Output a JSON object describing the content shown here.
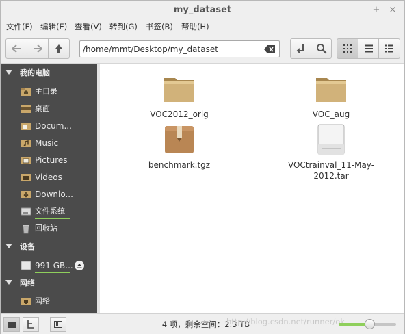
{
  "window": {
    "title": "my_dataset",
    "controls": {
      "minimize": "–",
      "maximize": "+",
      "close": "×"
    }
  },
  "menubar": {
    "items": [
      "文件(F)",
      "编辑(E)",
      "查看(V)",
      "转到(G)",
      "书签(B)",
      "帮助(H)"
    ]
  },
  "toolbar": {
    "location": "/home/mmt/Desktop/my_dataset",
    "icons": [
      "back-arrow-icon",
      "forward-arrow-icon",
      "up-arrow-icon",
      "clear-backspace-icon",
      "toggle-location-icon",
      "search-icon",
      "icon-view-icon",
      "list-view-icon",
      "compact-view-icon"
    ],
    "active_view": "icon-view"
  },
  "sidebar": {
    "sections": [
      {
        "label": "我的电脑",
        "items": [
          "主目录",
          "桌面",
          "Docum...",
          "Music",
          "Pictures",
          "Videos",
          "Downlo...",
          "文件系统",
          "回收站"
        ]
      },
      {
        "label": "设备",
        "items": [
          "991 GB..."
        ]
      },
      {
        "label": "网络",
        "items": [
          "网络"
        ]
      }
    ]
  },
  "files": [
    {
      "name": "VOC2012_orig",
      "type": "folder"
    },
    {
      "name": "VOC_aug",
      "type": "folder"
    },
    {
      "name": "benchmark.tgz",
      "type": "archive"
    },
    {
      "name": "VOCtrainval_11-May-2012.tar",
      "type": "tar"
    }
  ],
  "statusbar": {
    "text": "4 项，剩余空间：2.3 TB",
    "zoom_level": 0.55,
    "watermark": "http://blog.csdn.net/runner/ok"
  },
  "colors": {
    "sidebar_bg": "#4b4b4b",
    "accent_green": "#8fcf5c",
    "folder_tan": "#c9a76a"
  }
}
